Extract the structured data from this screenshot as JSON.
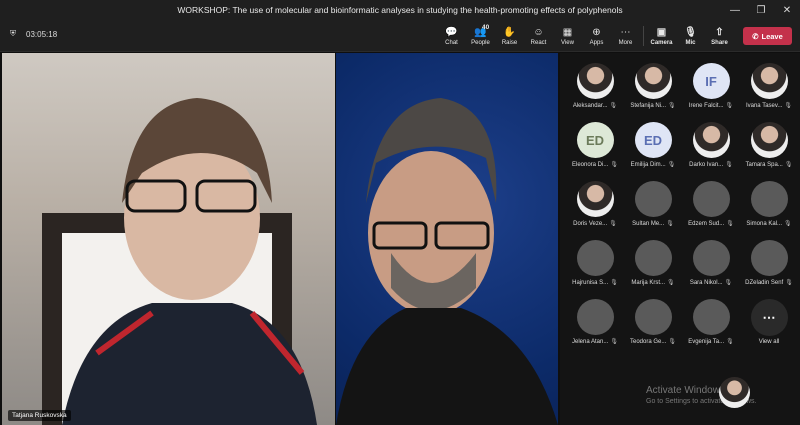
{
  "window": {
    "title": "WORKSHOP: The use of molecular and bioinformatic analyses in studying the health-promoting effects of polyphenols",
    "controls": [
      "—",
      "❐",
      "✕"
    ]
  },
  "toolbar": {
    "timer": "03:05:18",
    "items": [
      {
        "icon": "chat-icon",
        "glyph": "💬",
        "label": "Chat"
      },
      {
        "icon": "people-icon",
        "glyph": "👥",
        "label": "People",
        "badge": "40"
      },
      {
        "icon": "hand-icon",
        "glyph": "✋",
        "label": "Raise"
      },
      {
        "icon": "react-icon",
        "glyph": "☺",
        "label": "React"
      },
      {
        "icon": "view-icon",
        "glyph": "▦",
        "label": "View"
      },
      {
        "icon": "apps-icon",
        "glyph": "⊕",
        "label": "Apps"
      },
      {
        "icon": "more-icon",
        "glyph": "⋯",
        "label": "More"
      },
      {
        "icon": "camera-icon",
        "glyph": "▣",
        "label": "Camera"
      },
      {
        "icon": "mic-icon",
        "glyph": "🎙",
        "label": "Mic"
      },
      {
        "icon": "share-icon",
        "glyph": "⇧",
        "label": "Share"
      }
    ],
    "leave_label": "Leave"
  },
  "stage": {
    "main_speaker_name": "Tatjana Ruskovska"
  },
  "participants": [
    {
      "name": "Aleksandar...",
      "type": "photo"
    },
    {
      "name": "Stefanija Ni...",
      "type": "photo"
    },
    {
      "name": "Irene Falcit...",
      "type": "initials",
      "initials": "IF"
    },
    {
      "name": "Ivana Tasev...",
      "type": "photo"
    },
    {
      "name": "Eleonora Di...",
      "type": "initials-green",
      "initials": "ED"
    },
    {
      "name": "Emilija Dim...",
      "type": "initials",
      "initials": "ED"
    },
    {
      "name": "Darko Ivan...",
      "type": "photo"
    },
    {
      "name": "Tamara Spa...",
      "type": "photo"
    },
    {
      "name": "Doris Veze...",
      "type": "photo"
    },
    {
      "name": "Sultan Me...",
      "type": "blank"
    },
    {
      "name": "Edzem Sud...",
      "type": "blank"
    },
    {
      "name": "Simona Kal...",
      "type": "blank"
    },
    {
      "name": "Hajrunisa S...",
      "type": "blank"
    },
    {
      "name": "Marija Krst...",
      "type": "blank"
    },
    {
      "name": "Sara Nikol...",
      "type": "blank"
    },
    {
      "name": "DZeladin Senf",
      "type": "blank"
    },
    {
      "name": "Jelena Atan...",
      "type": "blank"
    },
    {
      "name": "Teodora Ge...",
      "type": "blank"
    },
    {
      "name": "Evgenija Ta...",
      "type": "blank"
    }
  ],
  "view_all_label": "View all",
  "watermark": {
    "line1": "Activate Windows",
    "line2": "Go to Settings to activate Windows."
  }
}
